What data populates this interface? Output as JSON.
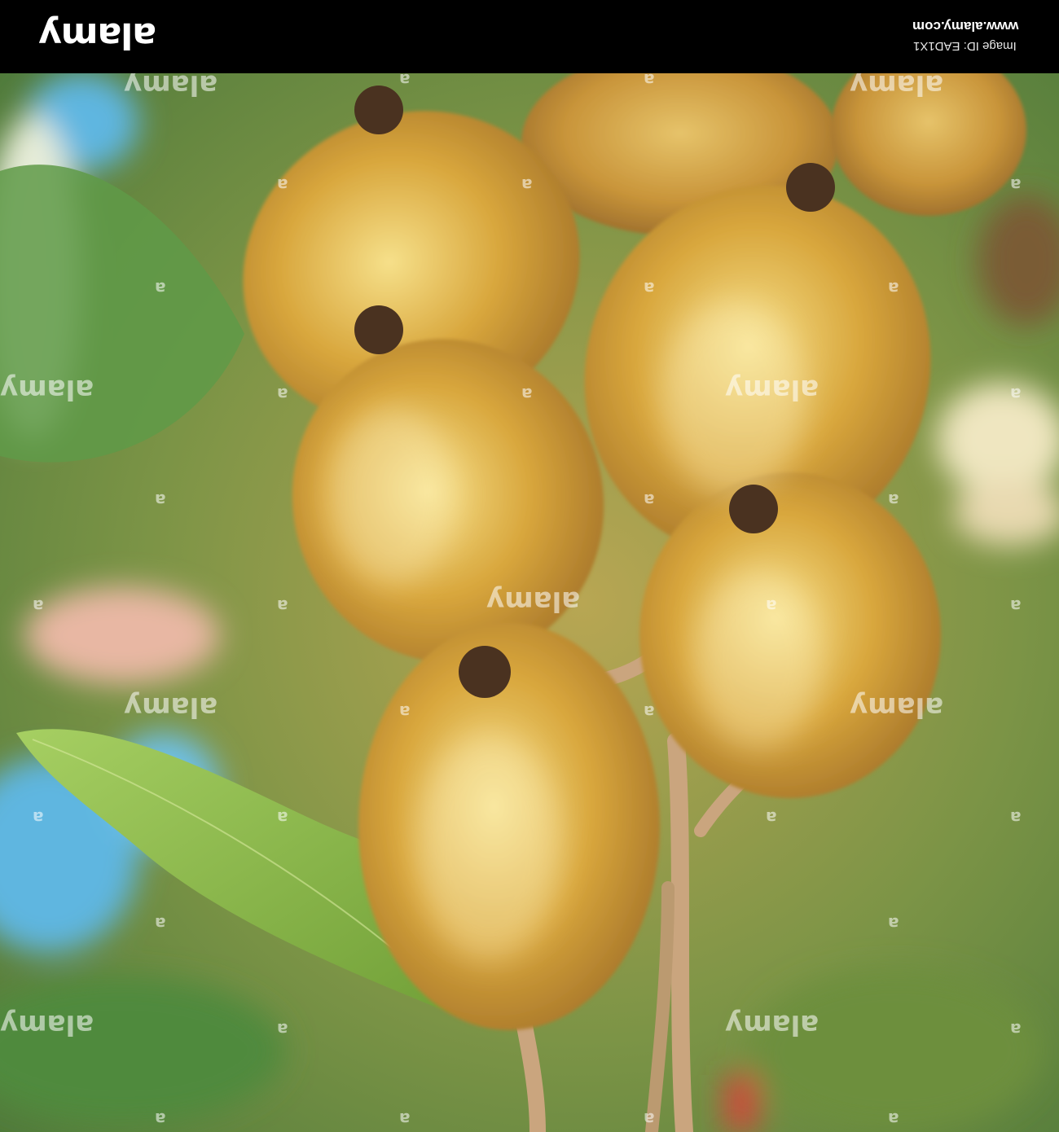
{
  "header": {
    "brand": "alamy",
    "url": "www.alamy.com",
    "image_id": "Image ID: EAD1X1"
  },
  "watermark": {
    "text": "alamy",
    "letter": "a"
  },
  "scene": {
    "subject": "kiwi-fruit-cluster",
    "colors": {
      "background_green": "#7c9446",
      "leaf_green": "#8fbf4a",
      "sky_blue": "#5fb6e0",
      "fruit_gold": "#d8a63c",
      "fruit_highlight": "#f6e08a",
      "stem": "#caa57e",
      "calyx": "#4a3220"
    }
  }
}
